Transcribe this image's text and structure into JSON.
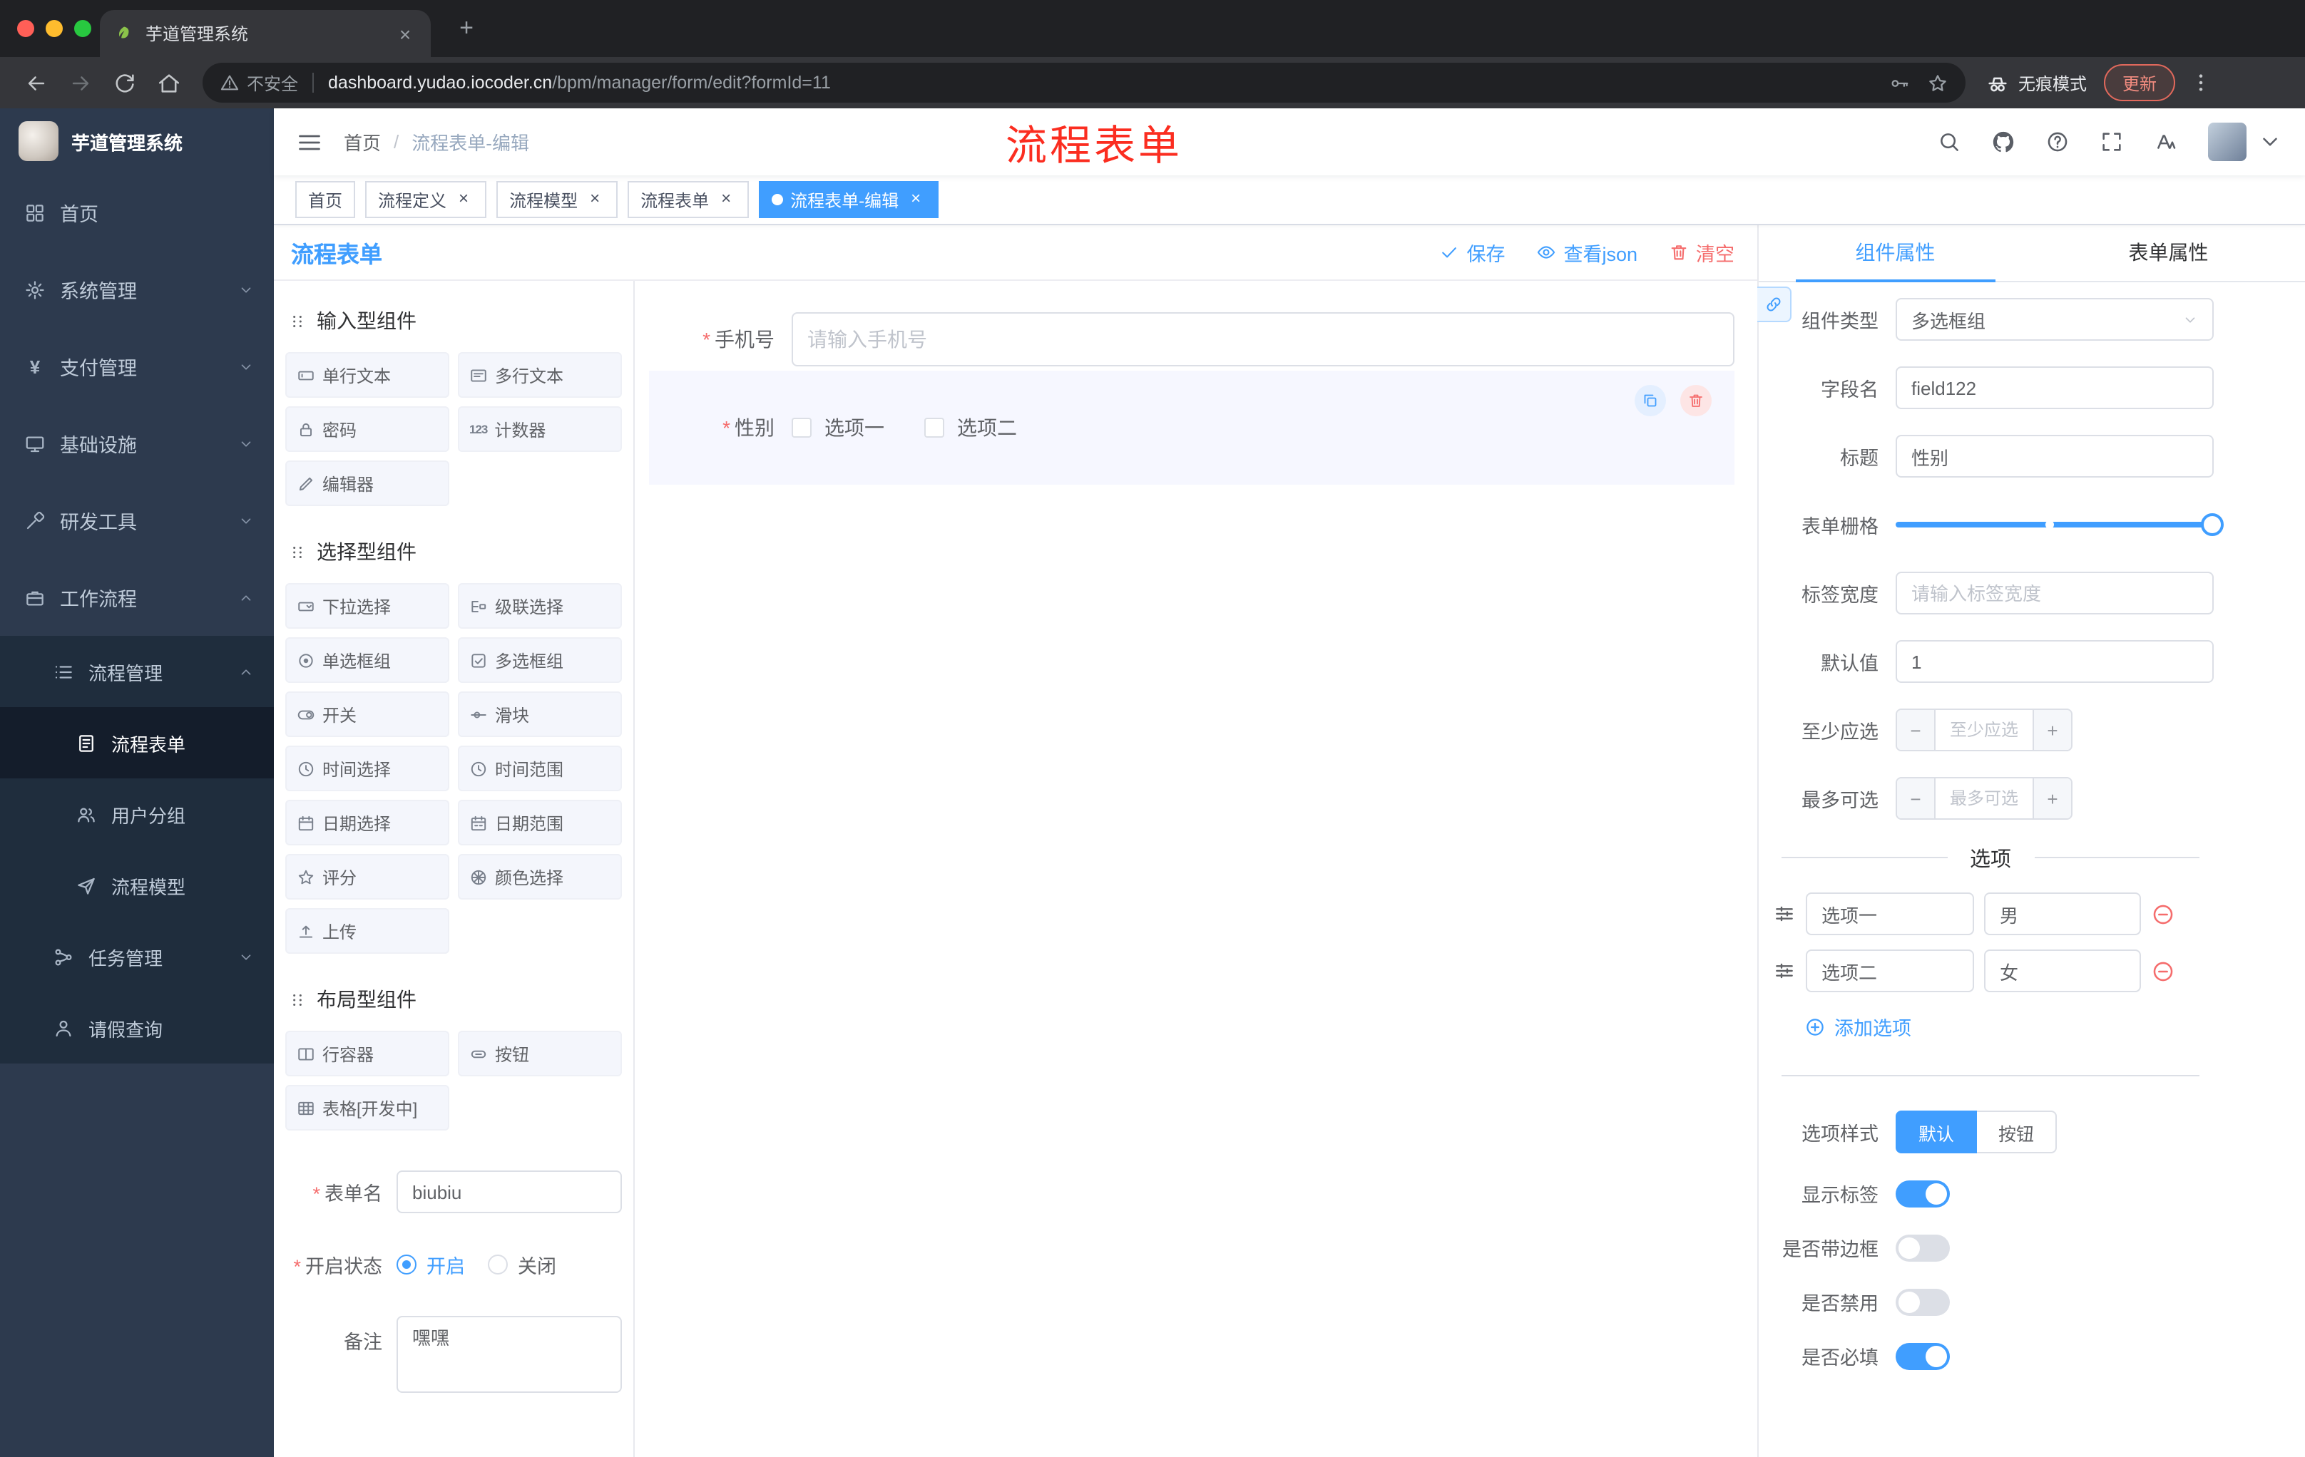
{
  "icons": {
    "close_glyph": "×",
    "plus_glyph": "+",
    "minus_glyph": "−",
    "counter_glyph": "123",
    "yen_glyph": "¥",
    "breadcrumb_separator": "/",
    "required_mark": "*"
  },
  "colors": {
    "primary": "#409eff",
    "danger": "#f56c6c",
    "annotation": "#fb2d20"
  },
  "browser": {
    "tab_title": "芋道管理系统",
    "security_label": "不安全",
    "url_host": "dashboard.yudao.iocoder.cn",
    "url_path": "/bpm/manager/form/edit?formId=11",
    "incognito_label": "无痕模式",
    "update_label": "更新"
  },
  "sidebar": {
    "logo_title": "芋道管理系统",
    "items": [
      {
        "label": "首页"
      },
      {
        "label": "系统管理"
      },
      {
        "label": "支付管理"
      },
      {
        "label": "基础设施"
      },
      {
        "label": "研发工具"
      },
      {
        "label": "工作流程"
      },
      {
        "label": "流程管理"
      },
      {
        "label": "流程表单"
      },
      {
        "label": "用户分组"
      },
      {
        "label": "流程模型"
      },
      {
        "label": "任务管理"
      },
      {
        "label": "请假查询"
      }
    ]
  },
  "navbar": {
    "breadcrumb_root": "首页",
    "breadcrumb_current": "流程表单-编辑",
    "annotation": "流程表单"
  },
  "tags": [
    {
      "label": "首页"
    },
    {
      "label": "流程定义"
    },
    {
      "label": "流程模型"
    },
    {
      "label": "流程表单"
    },
    {
      "label": "流程表单-编辑"
    }
  ],
  "editor": {
    "title": "流程表单",
    "save_label": "保存",
    "view_json_label": "查看json",
    "clear_label": "清空"
  },
  "palette": {
    "group1": {
      "title": "输入型组件",
      "items": [
        "单行文本",
        "多行文本",
        "密码",
        "计数器",
        "编辑器"
      ]
    },
    "group2": {
      "title": "选择型组件",
      "items": [
        "下拉选择",
        "级联选择",
        "单选框组",
        "多选框组",
        "开关",
        "滑块",
        "时间选择",
        "时间范围",
        "日期选择",
        "日期范围",
        "评分",
        "颜色选择",
        "上传"
      ]
    },
    "group3": {
      "title": "布局型组件",
      "items": [
        "行容器",
        "按钮",
        "表格[开发中]"
      ]
    }
  },
  "form_meta": {
    "name_label": "表单名",
    "name_value": "biubiu",
    "status_label": "开启状态",
    "status_on": "开启",
    "status_off": "关闭",
    "remark_label": "备注",
    "remark_value": "嘿嘿"
  },
  "canvas": {
    "phone_label": "手机号",
    "phone_placeholder": "请输入手机号",
    "gender_label": "性别",
    "gender_option1": "选项一",
    "gender_option2": "选项二"
  },
  "props": {
    "tab_component": "组件属性",
    "tab_form": "表单属性",
    "component_type_label": "组件类型",
    "component_type_value": "多选框组",
    "field_name_label": "字段名",
    "field_name_value": "field122",
    "title_label": "标题",
    "title_value": "性别",
    "grid_label": "表单栅格",
    "label_width_label": "标签宽度",
    "label_width_placeholder": "请输入标签宽度",
    "default_label": "默认值",
    "default_value": "1",
    "min_label": "至少应选",
    "min_placeholder": "至少应选",
    "max_label": "最多可选",
    "max_placeholder": "最多可选",
    "options_title": "选项",
    "option1_label": "选项一",
    "option1_value": "男",
    "option2_label": "选项二",
    "option2_value": "女",
    "add_option_label": "添加选项",
    "style_label": "选项样式",
    "style_default": "默认",
    "style_button": "按钮",
    "show_label_label": "显示标签",
    "border_label": "是否带边框",
    "disabled_label": "是否禁用",
    "required_label": "是否必填"
  }
}
